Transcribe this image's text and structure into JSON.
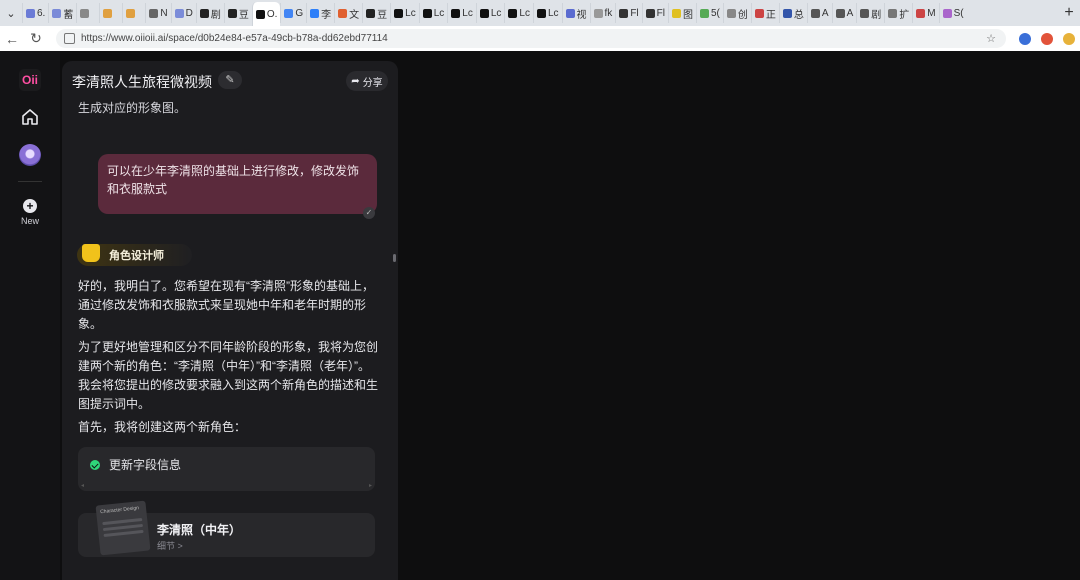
{
  "browser": {
    "tabs": [
      {
        "label": "6.",
        "color": "#6b7bd6"
      },
      {
        "label": "蓄",
        "color": "#7a8ad8"
      },
      {
        "label": "",
        "color": "#888"
      },
      {
        "label": "",
        "color": "#e0a040"
      },
      {
        "label": "",
        "color": "#e0a040"
      },
      {
        "label": "N",
        "color": "#666"
      },
      {
        "label": "D",
        "color": "#7b8cd9"
      },
      {
        "label": "剧",
        "color": "#222"
      },
      {
        "label": "豆",
        "color": "#222"
      },
      {
        "label": "O.",
        "color": "#111",
        "active": true
      },
      {
        "label": "G",
        "color": "#4285f4"
      },
      {
        "label": "李",
        "color": "#2d7ff9"
      },
      {
        "label": "文",
        "color": "#e06030"
      },
      {
        "label": "豆",
        "color": "#222"
      },
      {
        "label": "Lc",
        "color": "#111"
      },
      {
        "label": "Lc",
        "color": "#111"
      },
      {
        "label": "Lc",
        "color": "#111"
      },
      {
        "label": "Lc",
        "color": "#111"
      },
      {
        "label": "Lc",
        "color": "#111"
      },
      {
        "label": "Lc",
        "color": "#111"
      },
      {
        "label": "视",
        "color": "#5a6bd0"
      },
      {
        "label": "fk",
        "color": "#999"
      },
      {
        "label": "Fl",
        "color": "#333"
      },
      {
        "label": "Fl",
        "color": "#333"
      },
      {
        "label": "图",
        "color": "#e0c020"
      },
      {
        "label": "5(",
        "color": "#55aa55"
      },
      {
        "label": "创",
        "color": "#888"
      },
      {
        "label": "正",
        "color": "#cc4444"
      },
      {
        "label": "总",
        "color": "#3355aa"
      },
      {
        "label": "A",
        "color": "#555"
      },
      {
        "label": "A",
        "color": "#555"
      },
      {
        "label": "剧",
        "color": "#555"
      },
      {
        "label": "扩",
        "color": "#777"
      },
      {
        "label": "M",
        "color": "#cc4444"
      },
      {
        "label": "S(",
        "color": "#aa66cc"
      }
    ],
    "url": "https://www.oiioii.ai/space/d0b24e84-e57a-49cb-b78a-dd62ebd77114"
  },
  "rail": {
    "logo": "Oii",
    "new_label": "New"
  },
  "panel": {
    "title": "李清照人生旅程微视频",
    "share_label": "分享",
    "cut_text": "生成对应的形象图。",
    "user_message": "可以在少年李清照的基础上进行修改，修改发饰和衣服款式",
    "role_name": "角色设计师",
    "paragraphs": [
      "好的，我明白了。您希望在现有“李清照”形象的基础上，通过修改发饰和衣服款式来呈现她中年和老年时期的形象。",
      "为了更好地管理和区分不同年龄阶段的形象，我将为您创建两个新的角色：“李清照（中年）”和“李清照（老年）”。我会将您提出的修改要求融入到这两个新角色的描述和生图提示词中。",
      "首先，我将创建这两个新角色："
    ],
    "status_card": {
      "text": "更新字段信息"
    },
    "character_card": {
      "thumb_title": "Character Design",
      "name": "李清照（中年）",
      "sub": "细节 >"
    }
  },
  "colors": {
    "bubble": "#5b2a3c",
    "success": "#2fd57a",
    "badge": "#f1c21b"
  }
}
